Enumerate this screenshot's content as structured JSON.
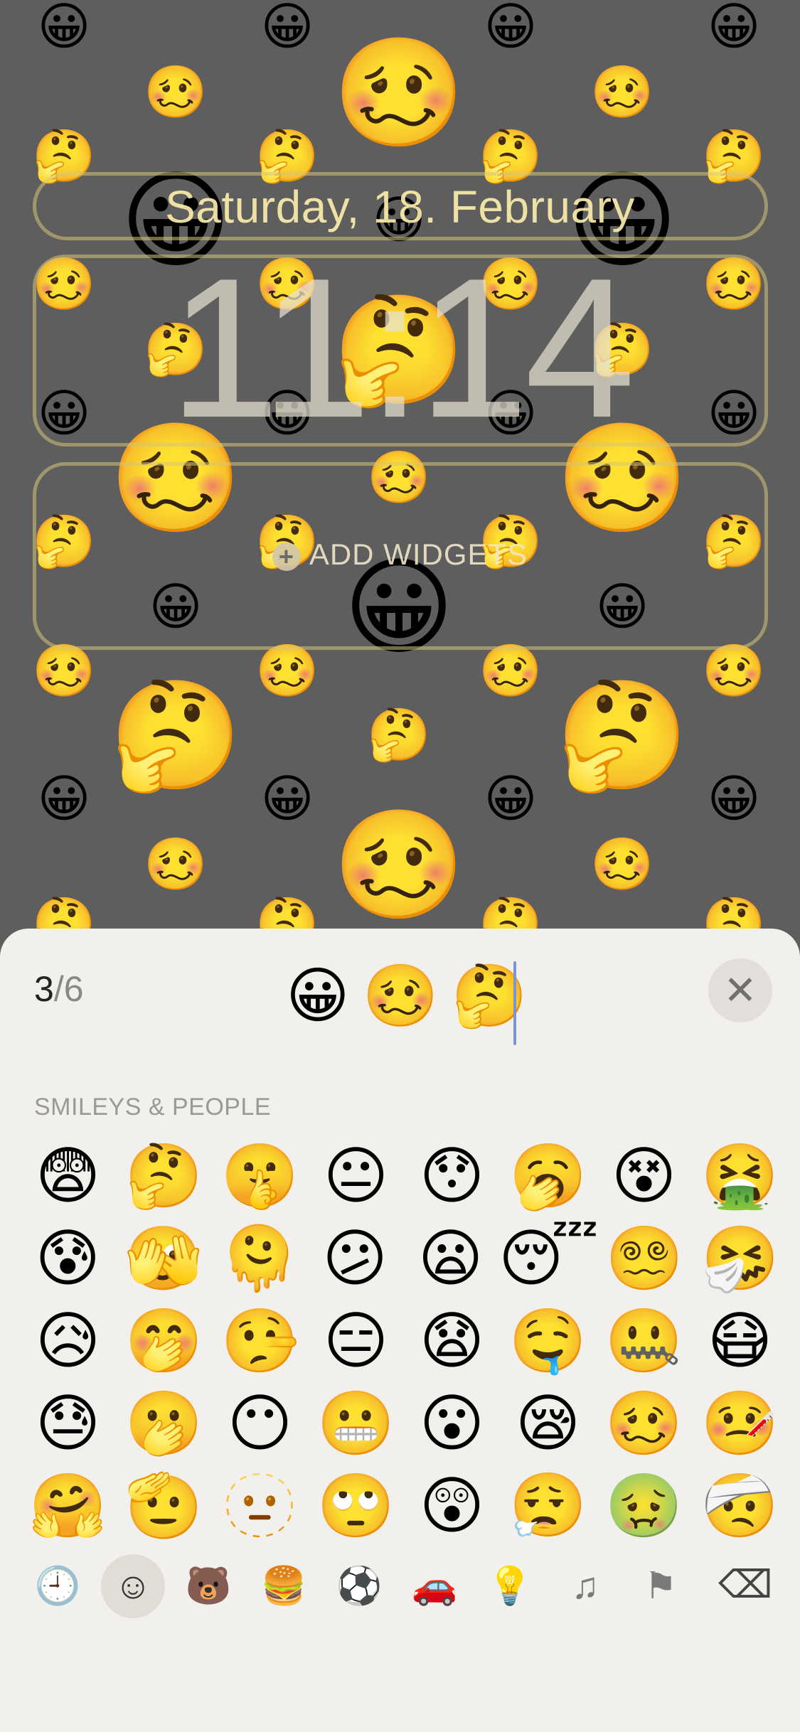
{
  "wallpaper": {
    "emoji": {
      "grin": "😀",
      "woozy": "🥴",
      "thinking": "🤔"
    }
  },
  "lockscreen": {
    "date": "Saturday, 18. February",
    "time": "11:14",
    "add_widgets_icon": "plus-circle-icon",
    "add_widgets_label": "ADD WIDGETS"
  },
  "picker": {
    "counter_current": "3",
    "counter_total": "/6",
    "selected": [
      "😀",
      "🥴",
      "🤔"
    ],
    "close_icon": "✕",
    "section_title": "SMILEYS & PEOPLE",
    "emoji_rows": [
      [
        "😨",
        "🤔",
        "🤫",
        "😐",
        "😯",
        "🥱",
        "😵",
        "🤮"
      ],
      [
        "😰",
        "🫣",
        "🫠",
        "😕",
        "😦",
        "😴",
        "😵‍💫",
        "🤧"
      ],
      [
        "😥",
        "🤭",
        "🤥",
        "😑",
        "😧",
        "🤤",
        "🤐",
        "😷"
      ],
      [
        "😓",
        "🫢",
        "😶",
        "😬",
        "😮",
        "😪",
        "🥴",
        "🤒"
      ],
      [
        "🤗",
        "🫡",
        "🫥",
        "🙄",
        "😲",
        "😮‍💨",
        "🤢",
        "🤕"
      ]
    ],
    "categories": [
      {
        "name": "recent-icon",
        "glyph": "🕘"
      },
      {
        "name": "smileys-icon",
        "glyph": "☺"
      },
      {
        "name": "animals-icon",
        "glyph": "🐻"
      },
      {
        "name": "food-icon",
        "glyph": "🍔"
      },
      {
        "name": "activity-icon",
        "glyph": "⚽"
      },
      {
        "name": "travel-icon",
        "glyph": "🚗"
      },
      {
        "name": "objects-icon",
        "glyph": "💡"
      },
      {
        "name": "symbols-icon",
        "glyph": "♫"
      },
      {
        "name": "flags-icon",
        "glyph": "⚑"
      }
    ],
    "delete_icon": "⌫"
  }
}
